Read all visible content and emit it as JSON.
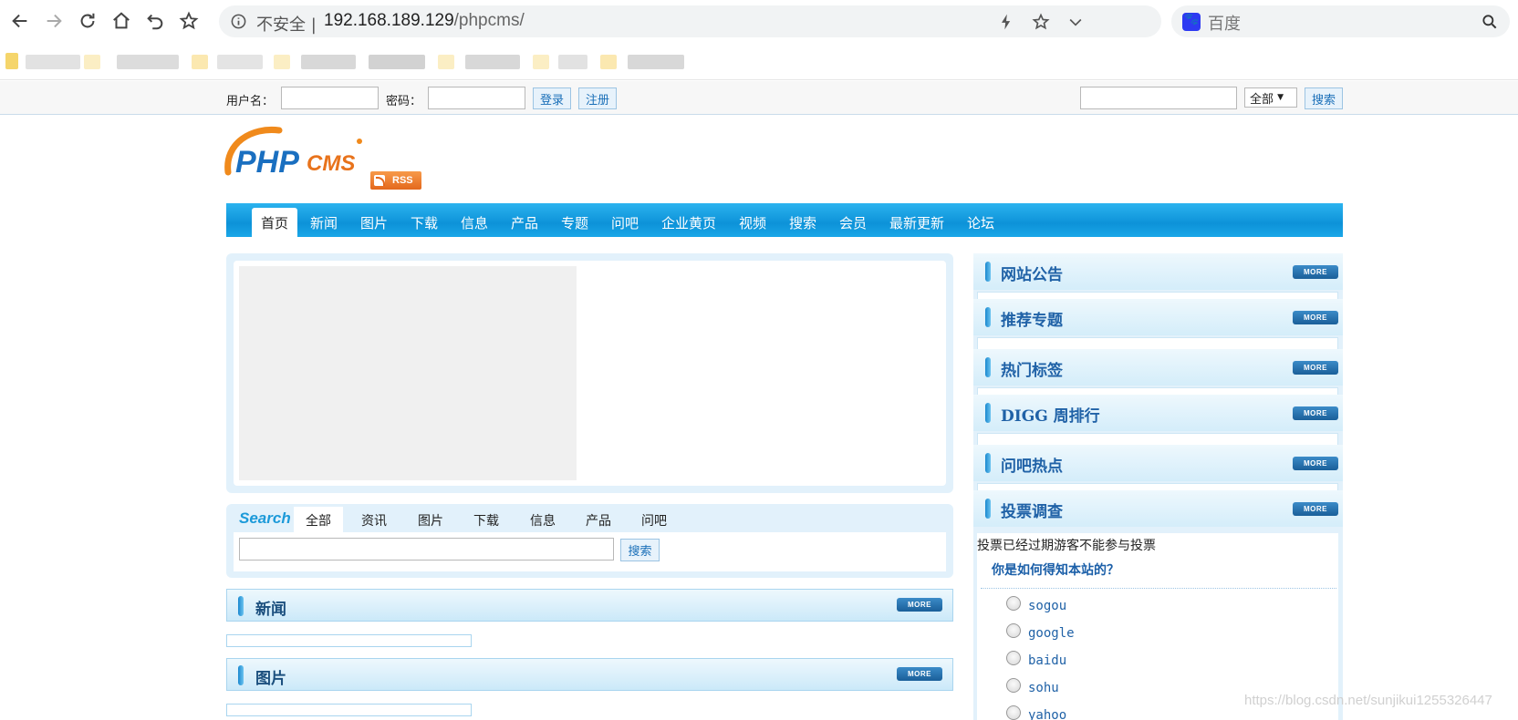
{
  "browser": {
    "insecure_label": "不安全",
    "url_host": "192.168.189.129",
    "url_path": "/phpcms/",
    "search_placeholder": "百度"
  },
  "topbar": {
    "username_label": "用户名：",
    "password_label": "密码：",
    "login_label": "登录",
    "register_label": "注册",
    "scope_value": "全部",
    "search_label": "搜索"
  },
  "logo": {
    "text_php": "PHP",
    "text_cms": "CMS",
    "rss_label": "RSS"
  },
  "nav": {
    "items": [
      "首页",
      "新闻",
      "图片",
      "下载",
      "信息",
      "产品",
      "专题",
      "问吧",
      "企业黄页",
      "视频",
      "搜索",
      "会员",
      "最新更新",
      "论坛"
    ]
  },
  "search_panel": {
    "logo_text": "Search",
    "tabs": [
      "全部",
      "资讯",
      "图片",
      "下载",
      "信息",
      "产品",
      "问吧"
    ],
    "button_label": "搜索"
  },
  "sections": {
    "news_title": "新闻",
    "pictures_title": "图片",
    "more_label": "MORE"
  },
  "sidebar": {
    "blocks": [
      "网站公告",
      "推荐专题",
      "热门标签",
      "DIGG 周排行",
      "问吧热点",
      "投票调查"
    ],
    "vote_note": "投票已经过期游客不能参与投票",
    "vote_question": "你是如何得知本站的？",
    "vote_options": [
      "sogou",
      "google",
      "baidu",
      "sohu",
      "yahoo"
    ]
  },
  "watermark": "https://blog.csdn.net/sunjikui1255326447"
}
